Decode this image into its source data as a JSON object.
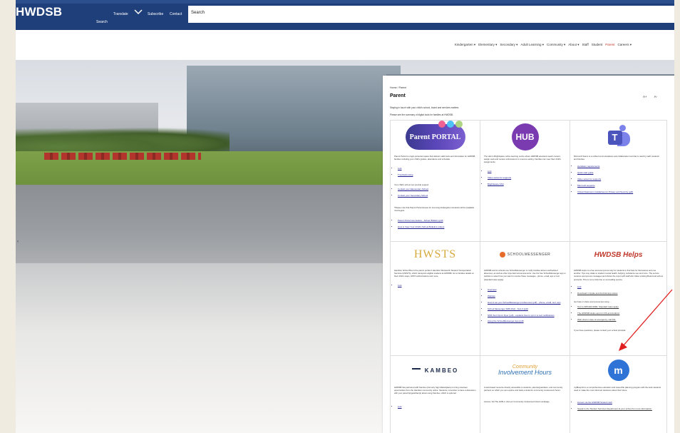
{
  "header": {
    "logo": "HWDSB",
    "links": [
      "Translate",
      "Subscribe",
      "Contact"
    ],
    "search_under": "Search",
    "search_placeholder": "Search"
  },
  "nav": {
    "items": [
      "Kindergarten ▾",
      "Elementary ▾",
      "Secondary ▾",
      "Adult Learning ▾",
      "Community ▾",
      "About ▾",
      "Staff",
      "Student",
      "Parent",
      "Careers ▾"
    ]
  },
  "panel": {
    "breadcrumb": "Home / Parent",
    "title": "Parent",
    "font_controls": [
      "A+",
      "A-"
    ],
    "intro1": "Staying in touch with your child's school, board and services matters.",
    "intro2": "Please see the summary of digital tools for families at HWDSB."
  },
  "cards": {
    "portal": {
      "logo": "Parent PORTAL",
      "desc": "Parent Portal is a login-protected space that delivers valid tools and information for HWDSB families including your child's grades, attendance and schedule.",
      "links": [
        "Link",
        "Troubleshooting"
      ],
      "support": "Your child's school can provide support.",
      "links2": [
        "Contact your Elementary School",
        "Contact your Secondary School"
      ],
      "note": "*Please note that Parent Portal Access for incoming kindergarten students will be available mid-August.",
      "links3": [
        "Parent Portal new feature - School Bulletin (pdf)",
        "How to View Your Child's School Bulletins (video)"
      ]
    },
    "hub": {
      "logo": "HUB",
      "desc": "The Hub is Brightspace online learning centre where HWDSB educators teach content, assign work and receive submissions in a secure setting. Families can view their child's assignments.",
      "links": [
        "Link",
        "Video series for supports",
        "Brightspace FAQ"
      ]
    },
    "teams": {
      "logo": "T",
      "desc": "Microsoft Teams is a unified communications and collaboration tool that is used by staff, students and families.",
      "links": [
        "Hardware requirements",
        "Quick start guide",
        "Video series for supports",
        "Microsoft supports",
        "Virtual Classroom Guidelines for Privacy and Security (pdf)"
      ]
    },
    "hwsts": {
      "logo": "HWSTS",
      "desc": "Hamilton School Bus is the parent portal of Hamilton Wentworth Student Transportation Services (HWSTS), which transports eligible students at HWDSB. Go to families details on their child's stops, HSTN authorizations and more.",
      "links": [
        "Link"
      ]
    },
    "sm": {
      "logo": "SCHOOLMESSENGER",
      "desc": "HWDSB and its schools use SchoolMessenger to notify families about unscheduled absences, as well as other important announcements. Use the free SchoolMessenger app or website to select how you want to receive these messages - phone, email, app or text (standard rates apply).",
      "links": [
        "Overview",
        "Website",
        "How to set your SchoolMessenger preferences (pdf) - phone, email, text, app",
        "School Messenger SMS FAQ - Text-It (pdf)",
        "SMS Text Opt-In Flyer (pdf) - explains how to opt in to text notifications",
        "Using the SchoolMessenger App (pdf)"
      ]
    },
    "helps": {
      "logo": "HWDSB Helps",
      "desc": "HWDSB Helps is a free and anonymous way for students to find help for themselves and one another. Tips may relate to student mental health, bullying, substance use and more. The service receives anonymous messages and shares the report with staff who follow existing Board and school protocols. This is not a crisis line or counselling service.",
      "links": [
        "Link",
        "Download in Apple and Android app stores"
      ],
      "help": "Get help or share anonymous tips using ...",
      "links2": [
        "Text to 905-963-9382. Standard rates apply.",
        "The HWDSB Helps app for iOS and Android.",
        "Web chat in case of emergency, call 911."
      ],
      "footer": "If you have questions, please contact your school principal."
    },
    "kambeo": {
      "logo": "KAMBEO",
      "desc": "HWDSB has partnered with Kambeo (formerly Sign Marketplace) to bring volunteer opportunities from the Hamilton community online. Students, remember to have a discussion with your parent(s)/guardian(s) about using Kambeo, which is optional.",
      "links": [
        "Link"
      ]
    },
    "chours": {
      "logo1": "Community",
      "logo2": "Involvement Hours",
      "desc": "A web-based resource directly accessible to students, parents/guardians, and community partners on which you can explore and track a student's community involvement hours.",
      "access": "Access: Via The HUB or visit our Community Involvement Hours webpage"
    },
    "mbp": {
      "logo": "m",
      "desc": "myBlueprint is a comprehensive education and career/life planning program with the tools students need to make the most informed decisions about their future.",
      "links": [
        "Access via the HWDSB Student Hub",
        "Speak to the Student Services Department at your school for more information."
      ]
    }
  },
  "colors": {
    "topbar": "#1f3f7a",
    "accent_red": "#c0392b",
    "link": "#1a1a8a",
    "arrow": "#e02020"
  }
}
